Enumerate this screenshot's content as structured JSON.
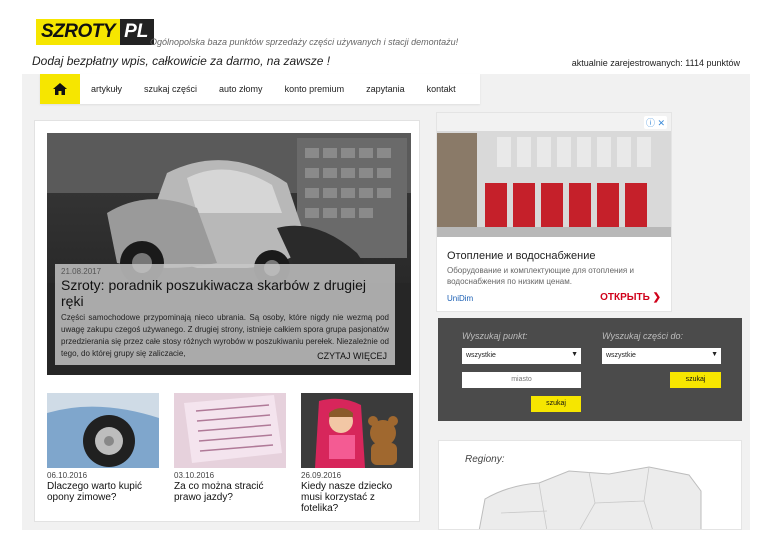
{
  "header": {
    "logo_primary": "SZROTY",
    "logo_secondary": "PL",
    "tagline": "Ogólnopolska baza punktów sprzedaży części używanych i stacji demontażu!",
    "slogan": "Dodaj bezpłatny wpis, całkowicie za darmo, na zawsze !",
    "registered": "aktualnie zarejestrowanych: 1114 punktów"
  },
  "nav": {
    "home_icon": "home-icon",
    "items": [
      {
        "label": "artykuły"
      },
      {
        "label": "szukaj części"
      },
      {
        "label": "auto złomy"
      },
      {
        "label": "konto premium"
      },
      {
        "label": "zapytania"
      },
      {
        "label": "kontakt"
      }
    ]
  },
  "featured": {
    "date": "21.08.2017",
    "title": "Szroty: poradnik poszukiwacza skarbów z drugiej ręki",
    "excerpt": "Części samochodowe przypominają nieco ubrania. Są osoby, które nigdy nie wezmą pod uwagę zakupu czegoś używanego. Z drugiej strony, istnieje całkiem spora grupa pasjonatów przedzierania się przez całe stosy różnych wyrobów w poszukiwaniu perełek. Niezależnie od tego, do której grupy się zaliczacie,",
    "more": "CZYTAJ WIĘCEJ"
  },
  "articles": [
    {
      "date": "06.10.2016",
      "title": "Dlaczego warto kupić opony zimowe?"
    },
    {
      "date": "03.10.2016",
      "title": "Za co można stracić prawo jazdy?"
    },
    {
      "date": "26.09.2016",
      "title": "Kiedy nasze dziecko musi korzystać z fotelika?"
    }
  ],
  "ad": {
    "info_label": "ⓘ ✕",
    "title": "Отопление и водоснабжение",
    "description": "Оборудование и комплектующие для отопления и водоснабжения по низким ценам.",
    "brand": "UniDim",
    "cta": "ОТКРЫТЬ  ❯"
  },
  "search": {
    "points_label": "Wyszukaj punkt:",
    "parts_label": "Wyszukaj części do:",
    "points_select": "wszystkie",
    "parts_select": "wszystkie",
    "city_placeholder": "miasto",
    "points_button": "szukaj",
    "parts_button": "szukaj",
    "select_arrow": "▼"
  },
  "regions": {
    "title": "Regiony:"
  },
  "colors": {
    "brand_yellow": "#f6e600",
    "search_bg": "#4b4b4b",
    "ad_cta": "#d0021b"
  }
}
